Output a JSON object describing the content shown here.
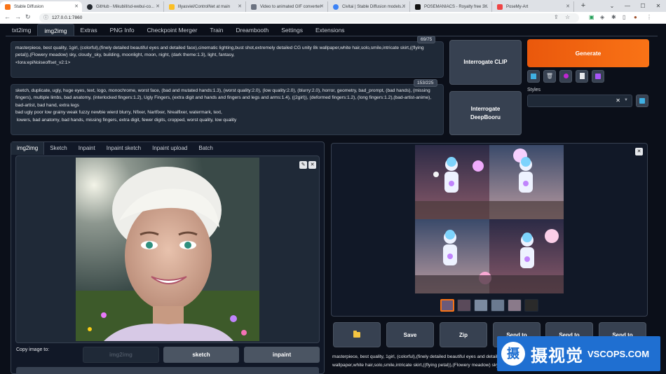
{
  "browser": {
    "tabs": [
      {
        "title": "Stable Diffusion",
        "color": "#f97316"
      },
      {
        "title": "GitHub - Mikubill/sd-webui-co...",
        "color": "#24292f"
      },
      {
        "title": "lllyasviel/ControlNet at main",
        "color": "#fbbf24"
      },
      {
        "title": "Video to animated GIF converter",
        "color": "#6b7280"
      },
      {
        "title": "Civitai | Stable Diffusion models...",
        "color": "#3b82f6"
      },
      {
        "title": "POSEMANIACS - Royalty free 3...",
        "color": "#111111"
      },
      {
        "title": "PoseMy-Art",
        "color": "#ef4444"
      }
    ],
    "url": "127.0.0.1:7860"
  },
  "app": {
    "tabs": [
      "txt2img",
      "img2img",
      "Extras",
      "PNG Info",
      "Checkpoint Merger",
      "Train",
      "Dreambooth",
      "Settings",
      "Extensions"
    ],
    "active_tab": "img2img",
    "prompt": {
      "text": "masterpiece, best quality, 1girl, (colorful),(finely detailed beautiful eyes and detailed face),cinematic lighting,bust shot,extremely detailed CG unity 8k wallpaper,white hair,solo,smile,intricate skirt,((flying petal)),(Flowery meadow) sky, cloudy_sky, building, moonlight, moon, night, (dark theme:1.3), light, fantasy,\n<lora:epiNoiseoffset_v2:1>",
      "counter": "69/75"
    },
    "negative_prompt": {
      "text": "sketch, duplicate, ugly, huge eyes, text, logo, monochrome, worst face, (bad and mutated hands:1.3), (worst quality:2.0), (low quality:2.0), (blurry:2.0), horror, geometry, bad_prompt, (bad hands), (missing fingers), multiple limbs, bad anatomy, (interlocked fingers:1.2), Ugly Fingers, (extra digit and hands and fingers and legs and arms:1.4), ((2girl)), (deformed fingers:1.2), (long fingers:1.2),(bad-artist-anime), bad-artist, bad hand, extra legs\nbad ugly poor low grainy weak fuzzy newbie wierd blurry, Nfixer, Nartfixer, Nrealfixer, watermark, text,\n lowers, bad anatomy, bad hands, missing fingers, extra digit, fewer digits, cropped, worst quality, low quality",
      "counter": "153/225"
    },
    "interrogate_clip": "Interrogate CLIP",
    "interrogate_deepbooru": "Interrogate DeepBooru",
    "generate": "Generate",
    "styles_label": "Styles",
    "subtabs": [
      "img2img",
      "Sketch",
      "Inpaint",
      "Inpaint sketch",
      "Inpaint upload",
      "Batch"
    ],
    "active_subtab": "img2img",
    "copy_image_label": "Copy image to:",
    "copy_buttons": [
      "img2img",
      "sketch",
      "inpaint"
    ],
    "action_buttons": [
      "Save",
      "Zip",
      "Send to",
      "Send to",
      "Send to"
    ],
    "output_text": "masterpiece, best quality, 1girl, (colorful),(finely detailed beautiful eyes and detailed face),cinematic lighting,bust shot,extremely detailed CG unity 8k wallpaper,white hair,solo,smile,intricate skirt,((flying petal)),(Flowery meadow) sky, cloudy_sky, building, moon..."
  },
  "icons": {
    "paint": "paint-icon",
    "trash": "trash-icon",
    "extra_networks": "extra-networks-icon",
    "paste": "clipboard-icon",
    "save_style": "save-style-icon",
    "folder": "folder-icon"
  },
  "watermark": {
    "logo_char": "摄",
    "cn": "摄视觉",
    "en": "VSCOPS.COM"
  },
  "colors": {
    "accent": "#f97316",
    "background": "#0b0f19",
    "panel": "#1f2937"
  }
}
